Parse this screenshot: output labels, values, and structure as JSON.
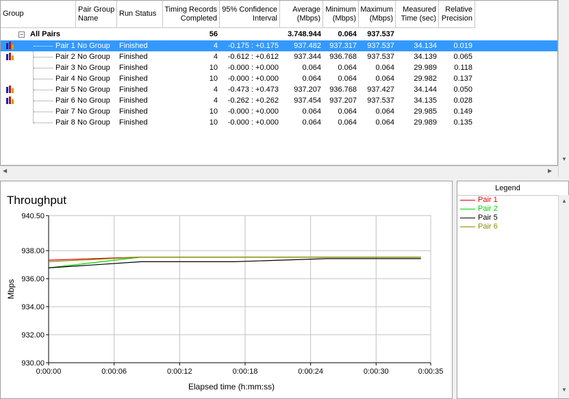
{
  "columns": [
    {
      "id": "group",
      "lines": [
        "Group"
      ],
      "align": "l"
    },
    {
      "id": "pair_group",
      "lines": [
        "Pair Group",
        "Name"
      ],
      "align": "l"
    },
    {
      "id": "run_status",
      "lines": [
        "Run Status"
      ],
      "align": "l"
    },
    {
      "id": "timing",
      "lines": [
        "Timing Records",
        "Completed"
      ],
      "align": "r"
    },
    {
      "id": "confidence",
      "lines": [
        "95% Confidence",
        "Interval"
      ],
      "align": "r"
    },
    {
      "id": "average",
      "lines": [
        "Average",
        "(Mbps)"
      ],
      "align": "r"
    },
    {
      "id": "minimum",
      "lines": [
        "Minimum",
        "(Mbps)"
      ],
      "align": "r"
    },
    {
      "id": "maximum",
      "lines": [
        "Maximum",
        "(Mbps)"
      ],
      "align": "r"
    },
    {
      "id": "measured",
      "lines": [
        "Measured",
        "Time (sec)"
      ],
      "align": "r"
    },
    {
      "id": "precision",
      "lines": [
        "Relative",
        "Precision"
      ],
      "align": "r"
    }
  ],
  "all_pairs": {
    "label": "All Pairs",
    "expander": "−",
    "timing": "56",
    "average": "3.748.944",
    "minimum": "0.064",
    "maximum": "937.537"
  },
  "rows": [
    {
      "pair": "Pair 1",
      "group": "No Group",
      "status": "Finished",
      "timing": "4",
      "confidence": "-0.175 : +0.175",
      "average": "937.482",
      "minimum": "937.317",
      "maximum": "937.537",
      "measured": "34.134",
      "precision": "0.019",
      "icon": true,
      "selected": true
    },
    {
      "pair": "Pair 2",
      "group": "No Group",
      "status": "Finished",
      "timing": "4",
      "confidence": "-0.612 : +0.612",
      "average": "937.344",
      "minimum": "936.768",
      "maximum": "937.537",
      "measured": "34.139",
      "precision": "0.065",
      "icon": true,
      "selected": false
    },
    {
      "pair": "Pair 3",
      "group": "No Group",
      "status": "Finished",
      "timing": "10",
      "confidence": "-0.000 : +0.000",
      "average": "0.064",
      "minimum": "0.064",
      "maximum": "0.064",
      "measured": "29.989",
      "precision": "0.118",
      "icon": false,
      "selected": false
    },
    {
      "pair": "Pair 4",
      "group": "No Group",
      "status": "Finished",
      "timing": "10",
      "confidence": "-0.000 : +0.000",
      "average": "0.064",
      "minimum": "0.064",
      "maximum": "0.064",
      "measured": "29.982",
      "precision": "0.137",
      "icon": false,
      "selected": false
    },
    {
      "pair": "Pair 5",
      "group": "No Group",
      "status": "Finished",
      "timing": "4",
      "confidence": "-0.473 : +0.473",
      "average": "937.207",
      "minimum": "936.768",
      "maximum": "937.427",
      "measured": "34.144",
      "precision": "0.050",
      "icon": true,
      "selected": false
    },
    {
      "pair": "Pair 6",
      "group": "No Group",
      "status": "Finished",
      "timing": "4",
      "confidence": "-0.262 : +0.262",
      "average": "937.454",
      "minimum": "937.207",
      "maximum": "937.537",
      "measured": "34.135",
      "precision": "0.028",
      "icon": true,
      "selected": false
    },
    {
      "pair": "Pair 7",
      "group": "No Group",
      "status": "Finished",
      "timing": "10",
      "confidence": "-0.000 : +0.000",
      "average": "0.064",
      "minimum": "0.064",
      "maximum": "0.064",
      "measured": "29.985",
      "precision": "0.149",
      "icon": false,
      "selected": false
    },
    {
      "pair": "Pair 8",
      "group": "No Group",
      "status": "Finished",
      "timing": "10",
      "confidence": "-0.000 : +0.000",
      "average": "0.064",
      "minimum": "0.064",
      "maximum": "0.064",
      "measured": "29.989",
      "precision": "0.135",
      "icon": false,
      "selected": false
    }
  ],
  "icon_colors": [
    "#1f1fb0",
    "#c01010",
    "#d0a000"
  ],
  "legend": {
    "title": "Legend"
  },
  "chart_data": {
    "type": "line",
    "title": "Throughput",
    "xlabel": "Elapsed time (h:mm:ss)",
    "ylabel": "Mbps",
    "xlim": [
      0,
      35
    ],
    "ylim": [
      930,
      940.5
    ],
    "x_ticks": [
      0,
      6,
      12,
      18,
      24,
      30,
      35
    ],
    "x_tick_labels": [
      "0:00:00",
      "0:00:06",
      "0:00:12",
      "0:00:18",
      "0:00:24",
      "0:00:30",
      "0:00:35"
    ],
    "y_ticks": [
      930,
      932,
      934,
      936,
      938,
      940.5
    ],
    "y_tick_labels": [
      "930.00",
      "932.00",
      "934.00",
      "936.00",
      "938.00",
      "940.50"
    ],
    "grid": true,
    "legend_position": "separate-panel-right",
    "series": [
      {
        "name": "Pair 1",
        "color": "#e00000",
        "x": [
          0,
          8.5,
          17,
          25.5,
          34.1
        ],
        "y": [
          937.32,
          937.54,
          937.54,
          937.54,
          937.54
        ]
      },
      {
        "name": "Pair 2",
        "color": "#00d000",
        "x": [
          0,
          8.5,
          17,
          25.5,
          34.1
        ],
        "y": [
          936.77,
          937.54,
          937.54,
          937.54,
          937.54
        ]
      },
      {
        "name": "Pair 5",
        "color": "#000000",
        "x": [
          0,
          8.5,
          17,
          25.5,
          34.1
        ],
        "y": [
          936.77,
          937.21,
          937.21,
          937.43,
          937.43
        ]
      },
      {
        "name": "Pair 6",
        "color": "#8a8a00",
        "x": [
          0,
          8.5,
          17,
          25.5,
          34.1
        ],
        "y": [
          937.21,
          937.54,
          937.54,
          937.54,
          937.54
        ]
      }
    ]
  }
}
